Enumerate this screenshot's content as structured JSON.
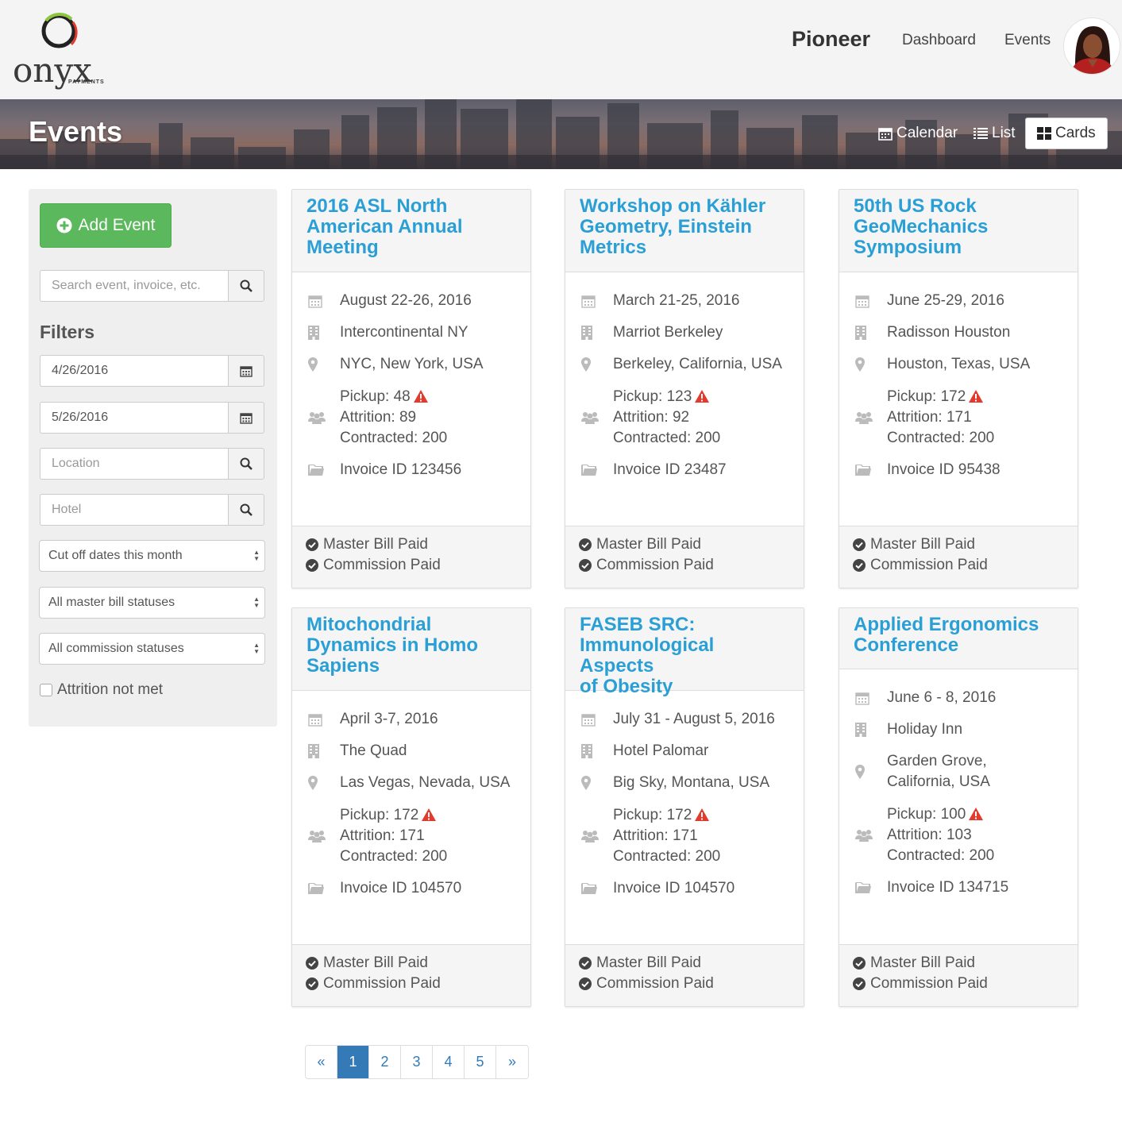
{
  "brand": {
    "logo_text": "onyx",
    "logo_sub": "PAYMENTS"
  },
  "nav": {
    "brand": "Pioneer",
    "links": [
      "Dashboard",
      "Events"
    ]
  },
  "banner": {
    "title": "Events",
    "views": [
      "Calendar",
      "List",
      "Cards"
    ],
    "active_view": "Cards"
  },
  "sidebar": {
    "add_label": "Add Event",
    "search_placeholder": "Search event, invoice, etc.",
    "filters_title": "Filters",
    "start_date": "4/26/2016",
    "end_date": "5/26/2016",
    "location_placeholder": "Location",
    "hotel_placeholder": "Hotel",
    "cutoff_select": "Cut off dates this month",
    "master_bill_select": "All master bill statuses",
    "commission_select": "All commission statuses",
    "attrition_checkbox": "Attrition not met"
  },
  "cards": [
    {
      "title": [
        "2016 ASL North",
        "American Annual",
        "Meeting"
      ],
      "dates": "August 22-26, 2016",
      "hotel": "Intercontinental NY",
      "location": [
        "NYC, New York, USA"
      ],
      "pickup": "Pickup: 48",
      "attrition": "Attrition: 89",
      "contracted": "Contracted: 200",
      "invoice": "Invoice ID 123456",
      "master_bill": "Master Bill Paid",
      "commission": "Commission Paid"
    },
    {
      "title": [
        "Workshop on Kähler",
        "Geometry, Einstein",
        "Metrics"
      ],
      "dates": "March 21-25, 2016",
      "hotel": "Marriot Berkeley",
      "location": [
        "Berkeley, California, USA"
      ],
      "pickup": "Pickup: 123",
      "attrition": "Attrition: 92",
      "contracted": "Contracted: 200",
      "invoice": "Invoice ID 23487",
      "master_bill": "Master Bill Paid",
      "commission": "Commission Paid"
    },
    {
      "title": [
        "50th US Rock",
        "GeoMechanics",
        "Symposium"
      ],
      "dates": "June 25-29, 2016",
      "hotel": "Radisson Houston",
      "location": [
        "Houston, Texas, USA"
      ],
      "pickup": "Pickup: 172",
      "attrition": "Attrition: 171",
      "contracted": "Contracted: 200",
      "invoice": "Invoice ID 95438",
      "master_bill": "Master Bill Paid",
      "commission": "Commission Paid"
    },
    {
      "title": [
        "Mitochondrial",
        "Dynamics in Homo",
        "Sapiens"
      ],
      "dates": "April 3-7, 2016",
      "hotel": "The Quad",
      "location": [
        "Las Vegas, Nevada, USA"
      ],
      "pickup": "Pickup: 172",
      "attrition": "Attrition: 171",
      "contracted": "Contracted: 200",
      "invoice": "Invoice ID 104570",
      "master_bill": "Master Bill Paid",
      "commission": "Commission Paid"
    },
    {
      "title": [
        "FASEB SRC:",
        "Immunological Aspects",
        "of Obesity"
      ],
      "dates": "July 31 - August 5, 2016",
      "hotel": "Hotel Palomar",
      "location": [
        "Big Sky, Montana, USA"
      ],
      "pickup": "Pickup: 172",
      "attrition": "Attrition: 171",
      "contracted": "Contracted: 200",
      "invoice": "Invoice ID 104570",
      "master_bill": "Master Bill Paid",
      "commission": "Commission Paid"
    },
    {
      "title": [
        "Applied Ergonomics",
        "Conference"
      ],
      "dates": "June 6 - 8, 2016",
      "hotel": "Holiday Inn",
      "location": [
        "Garden Grove,",
        "California, USA"
      ],
      "pickup": "Pickup: 100",
      "attrition": "Attrition: 103",
      "contracted": "Contracted: 200",
      "invoice": "Invoice ID 134715",
      "master_bill": "Master Bill Paid",
      "commission": "Commission Paid"
    }
  ],
  "pagination": {
    "prev": "«",
    "pages": [
      "1",
      "2",
      "3",
      "4",
      "5"
    ],
    "next": "»",
    "current": "1"
  },
  "colors": {
    "accent": "#2a9fd6",
    "success": "#5cb85c",
    "warning": "#e23b2e",
    "page_active": "#337ab7"
  },
  "icons": [
    "calendar-icon",
    "building-icon",
    "map-marker-icon",
    "users-icon",
    "folder-icon",
    "check-circle-icon",
    "warning-icon",
    "search-icon",
    "plus-circle-icon",
    "list-icon",
    "th-large-icon"
  ]
}
